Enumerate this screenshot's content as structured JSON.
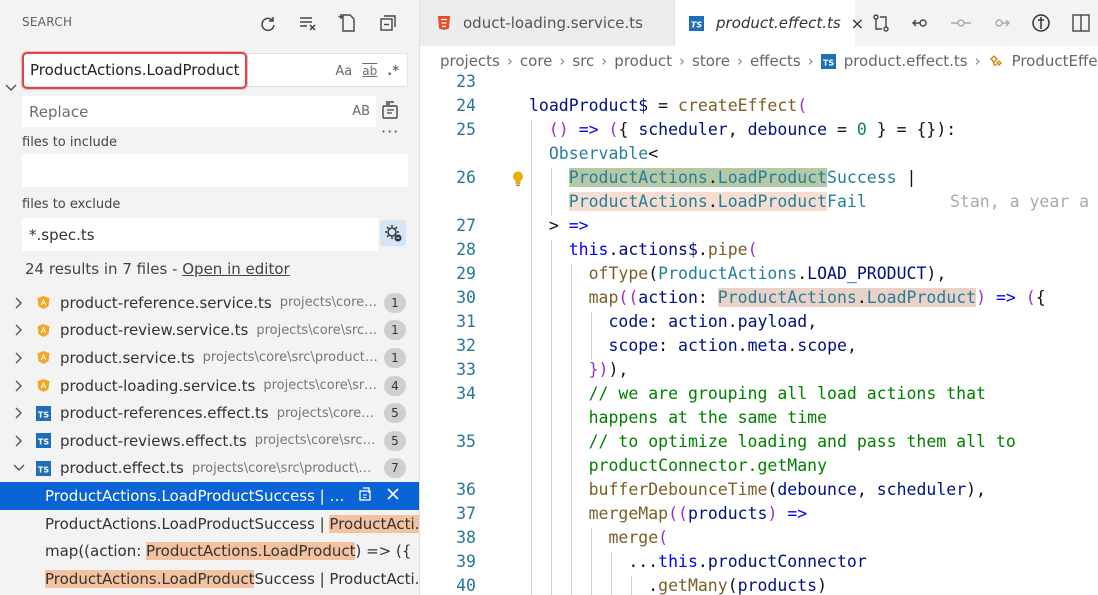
{
  "sidebar": {
    "title": "SEARCH",
    "search": {
      "value": "ProductActions.LoadProduct",
      "opt_case": "Aa",
      "opt_word": "ab",
      "opt_regex": ".*"
    },
    "replace": {
      "placeholder": "Replace",
      "opt_preserve_case": "AB"
    },
    "more": "···",
    "include": {
      "label": "files to include",
      "value": ""
    },
    "exclude": {
      "label": "files to exclude",
      "value": "*.spec.ts"
    },
    "summary": {
      "text": "24 results in 7 files - ",
      "link": "Open in editor"
    },
    "files": [
      {
        "name": "product-reference.service.ts",
        "path": "projects\\core\\s...",
        "count": "1",
        "icon": "angular-icon",
        "expanded": false
      },
      {
        "name": "product-review.service.ts",
        "path": "projects\\core\\src\\...",
        "count": "1",
        "icon": "angular-icon",
        "expanded": false
      },
      {
        "name": "product.service.ts",
        "path": "projects\\core\\src\\product\\...",
        "count": "1",
        "icon": "angular-icon",
        "expanded": false
      },
      {
        "name": "product-loading.service.ts",
        "path": "projects\\core\\src...",
        "count": "4",
        "icon": "angular-icon",
        "expanded": false
      },
      {
        "name": "product-references.effect.ts",
        "path": "projects\\core\\s...",
        "count": "5",
        "icon": "ts-icon",
        "expanded": false
      },
      {
        "name": "product-reviews.effect.ts",
        "path": "projects\\core\\src\\p...",
        "count": "5",
        "icon": "ts-icon",
        "expanded": false
      },
      {
        "name": "product.effect.ts",
        "path": "projects\\core\\src\\product\\st...",
        "count": "7",
        "icon": "ts-icon",
        "expanded": true
      }
    ],
    "matches": [
      {
        "pre": "",
        "hl": "ProductActions.LoadProduct",
        "post": "Success | Pr...",
        "selected": true
      },
      {
        "pre": "ProductActions.LoadProductSuccess | ",
        "hl": "ProductActi...",
        "post": "",
        "selected": false
      },
      {
        "pre": "map((action: ",
        "hl": "ProductActions.LoadProduct",
        "post": ") => ({",
        "selected": false
      },
      {
        "pre": "",
        "hl": "ProductActions.LoadProduct",
        "post": "Success | ProductActi...",
        "selected": false
      }
    ]
  },
  "editor": {
    "tabs": [
      {
        "label": "oduct-loading.service.ts",
        "icon": "html5-icon"
      },
      {
        "label": "product.effect.ts",
        "icon": "ts-icon",
        "close": "×"
      }
    ],
    "breadcrumb": [
      "projects",
      "core",
      "src",
      "product",
      "store",
      "effects",
      "product.effect.ts",
      "ProductEffect"
    ],
    "blame": "Stan, a year a"
  },
  "colors": {
    "accent": "#0a64d6",
    "search_highlight_border": "#d94848",
    "match_highlight": "#f3c2a0",
    "line_number": "#237893",
    "keyword": "#0000ff",
    "function": "#795e26",
    "type": "#267f99"
  }
}
